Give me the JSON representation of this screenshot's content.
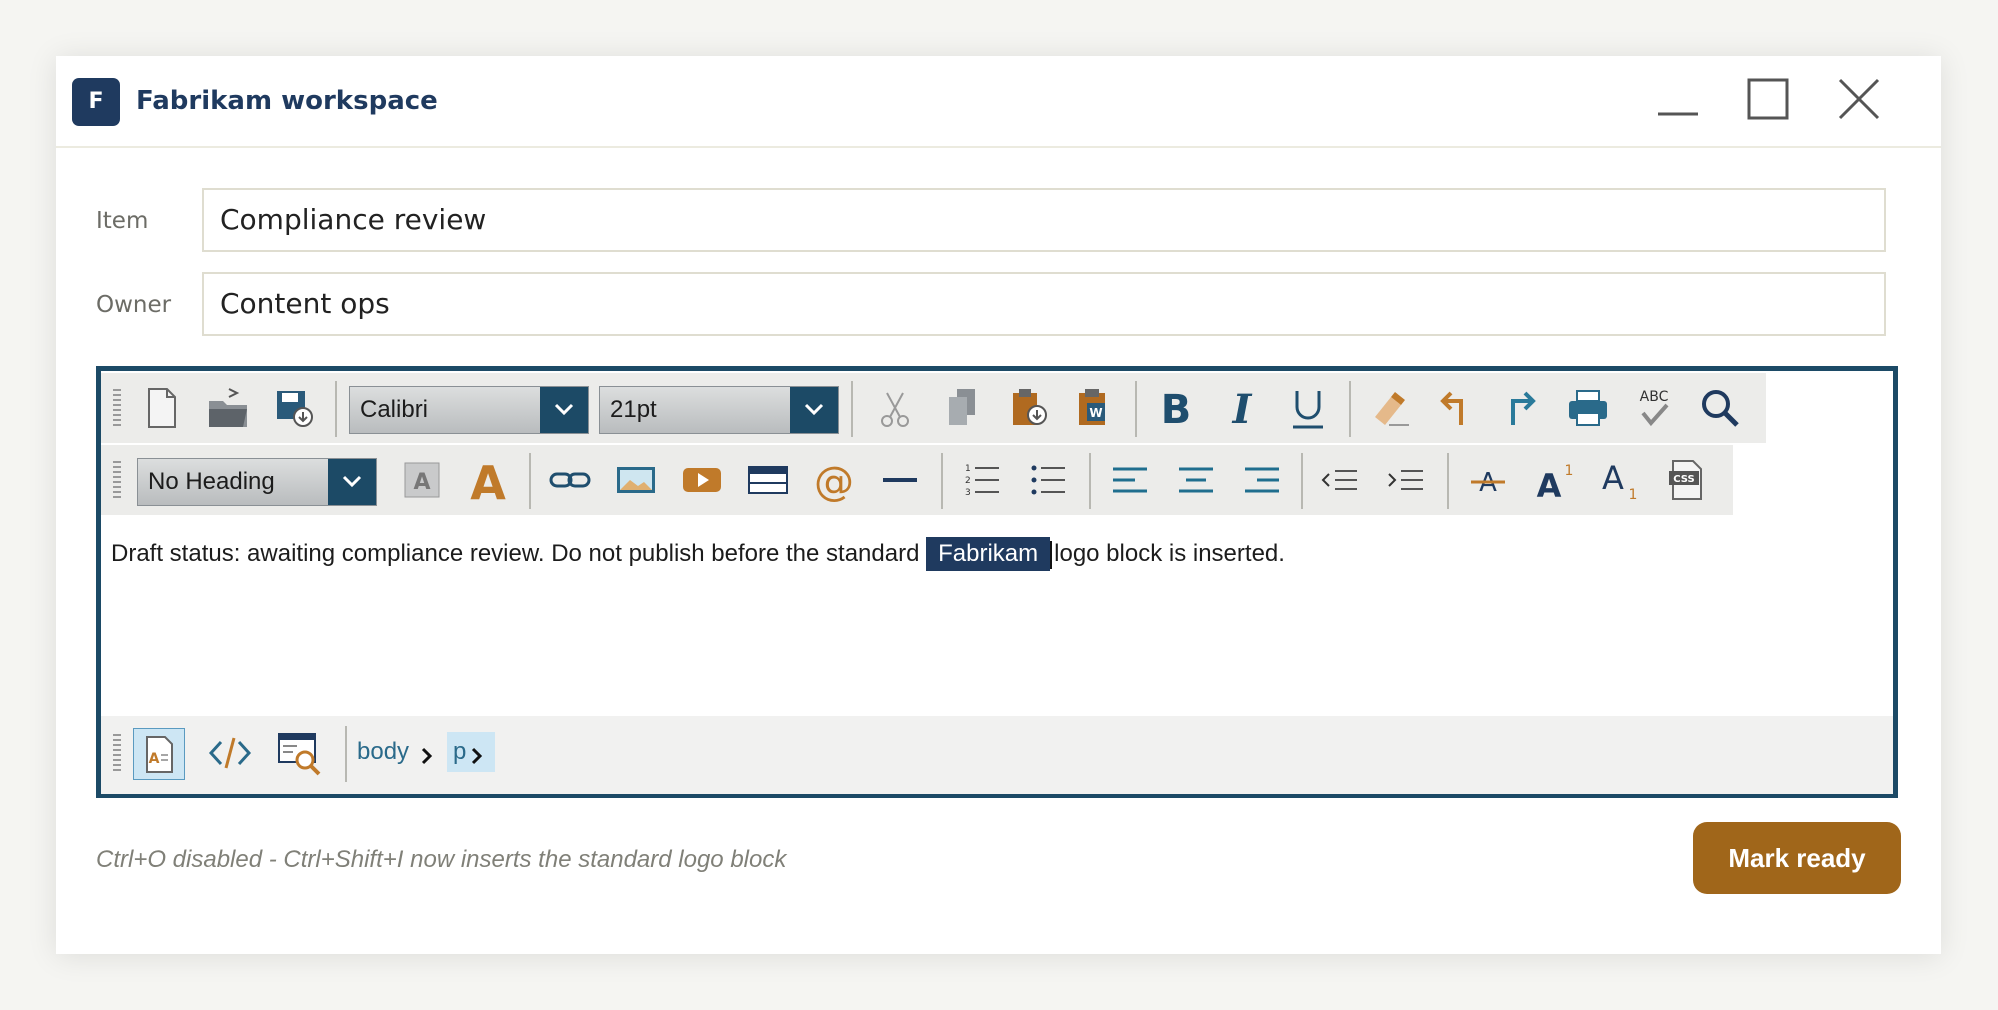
{
  "window": {
    "app_initial": "F",
    "title": "Fabrikam workspace"
  },
  "form": {
    "item_label": "Item",
    "item_value": "Compliance review",
    "owner_label": "Owner",
    "owner_value": "Content ops"
  },
  "toolbar": {
    "font_value": "Calibri",
    "size_value": "21pt",
    "heading_value": "No Heading"
  },
  "editor_content": {
    "text_before": "Draft status: awaiting compliance review. Do not publish before the standard ",
    "selected_text": "Fabrikam",
    "text_after": "logo block is inserted."
  },
  "breadcrumb": {
    "items": [
      "body",
      "p"
    ]
  },
  "footer": {
    "hint": "Ctrl+O disabled - Ctrl+Shift+I now inserts the standard logo block",
    "primary_button": "Mark ready"
  },
  "colors": {
    "navy": "#1f3a5f",
    "teal": "#1c4a66",
    "accent_orange": "#c07a2a",
    "button": "#a0661a"
  },
  "icons": {
    "row1": [
      "new-document-icon",
      "open-folder-icon",
      "save-icon",
      "cut-icon",
      "copy-icon",
      "paste-icon",
      "paste-from-word-icon",
      "bold-icon",
      "italic-icon",
      "underline-icon",
      "eraser-icon",
      "undo-icon",
      "redo-icon",
      "print-icon",
      "spellcheck-icon",
      "find-icon"
    ],
    "row2": [
      "background-color-icon",
      "font-color-icon",
      "link-icon",
      "image-icon",
      "video-icon",
      "table-icon",
      "email-link-icon",
      "horizontal-rule-icon",
      "ordered-list-icon",
      "unordered-list-icon",
      "align-left-icon",
      "align-center-icon",
      "align-right-icon",
      "outdent-icon",
      "indent-icon",
      "strikethrough-icon",
      "superscript-icon",
      "subscript-icon",
      "css-icon"
    ],
    "status": [
      "design-mode-icon",
      "html-mode-icon",
      "preview-mode-icon"
    ]
  }
}
